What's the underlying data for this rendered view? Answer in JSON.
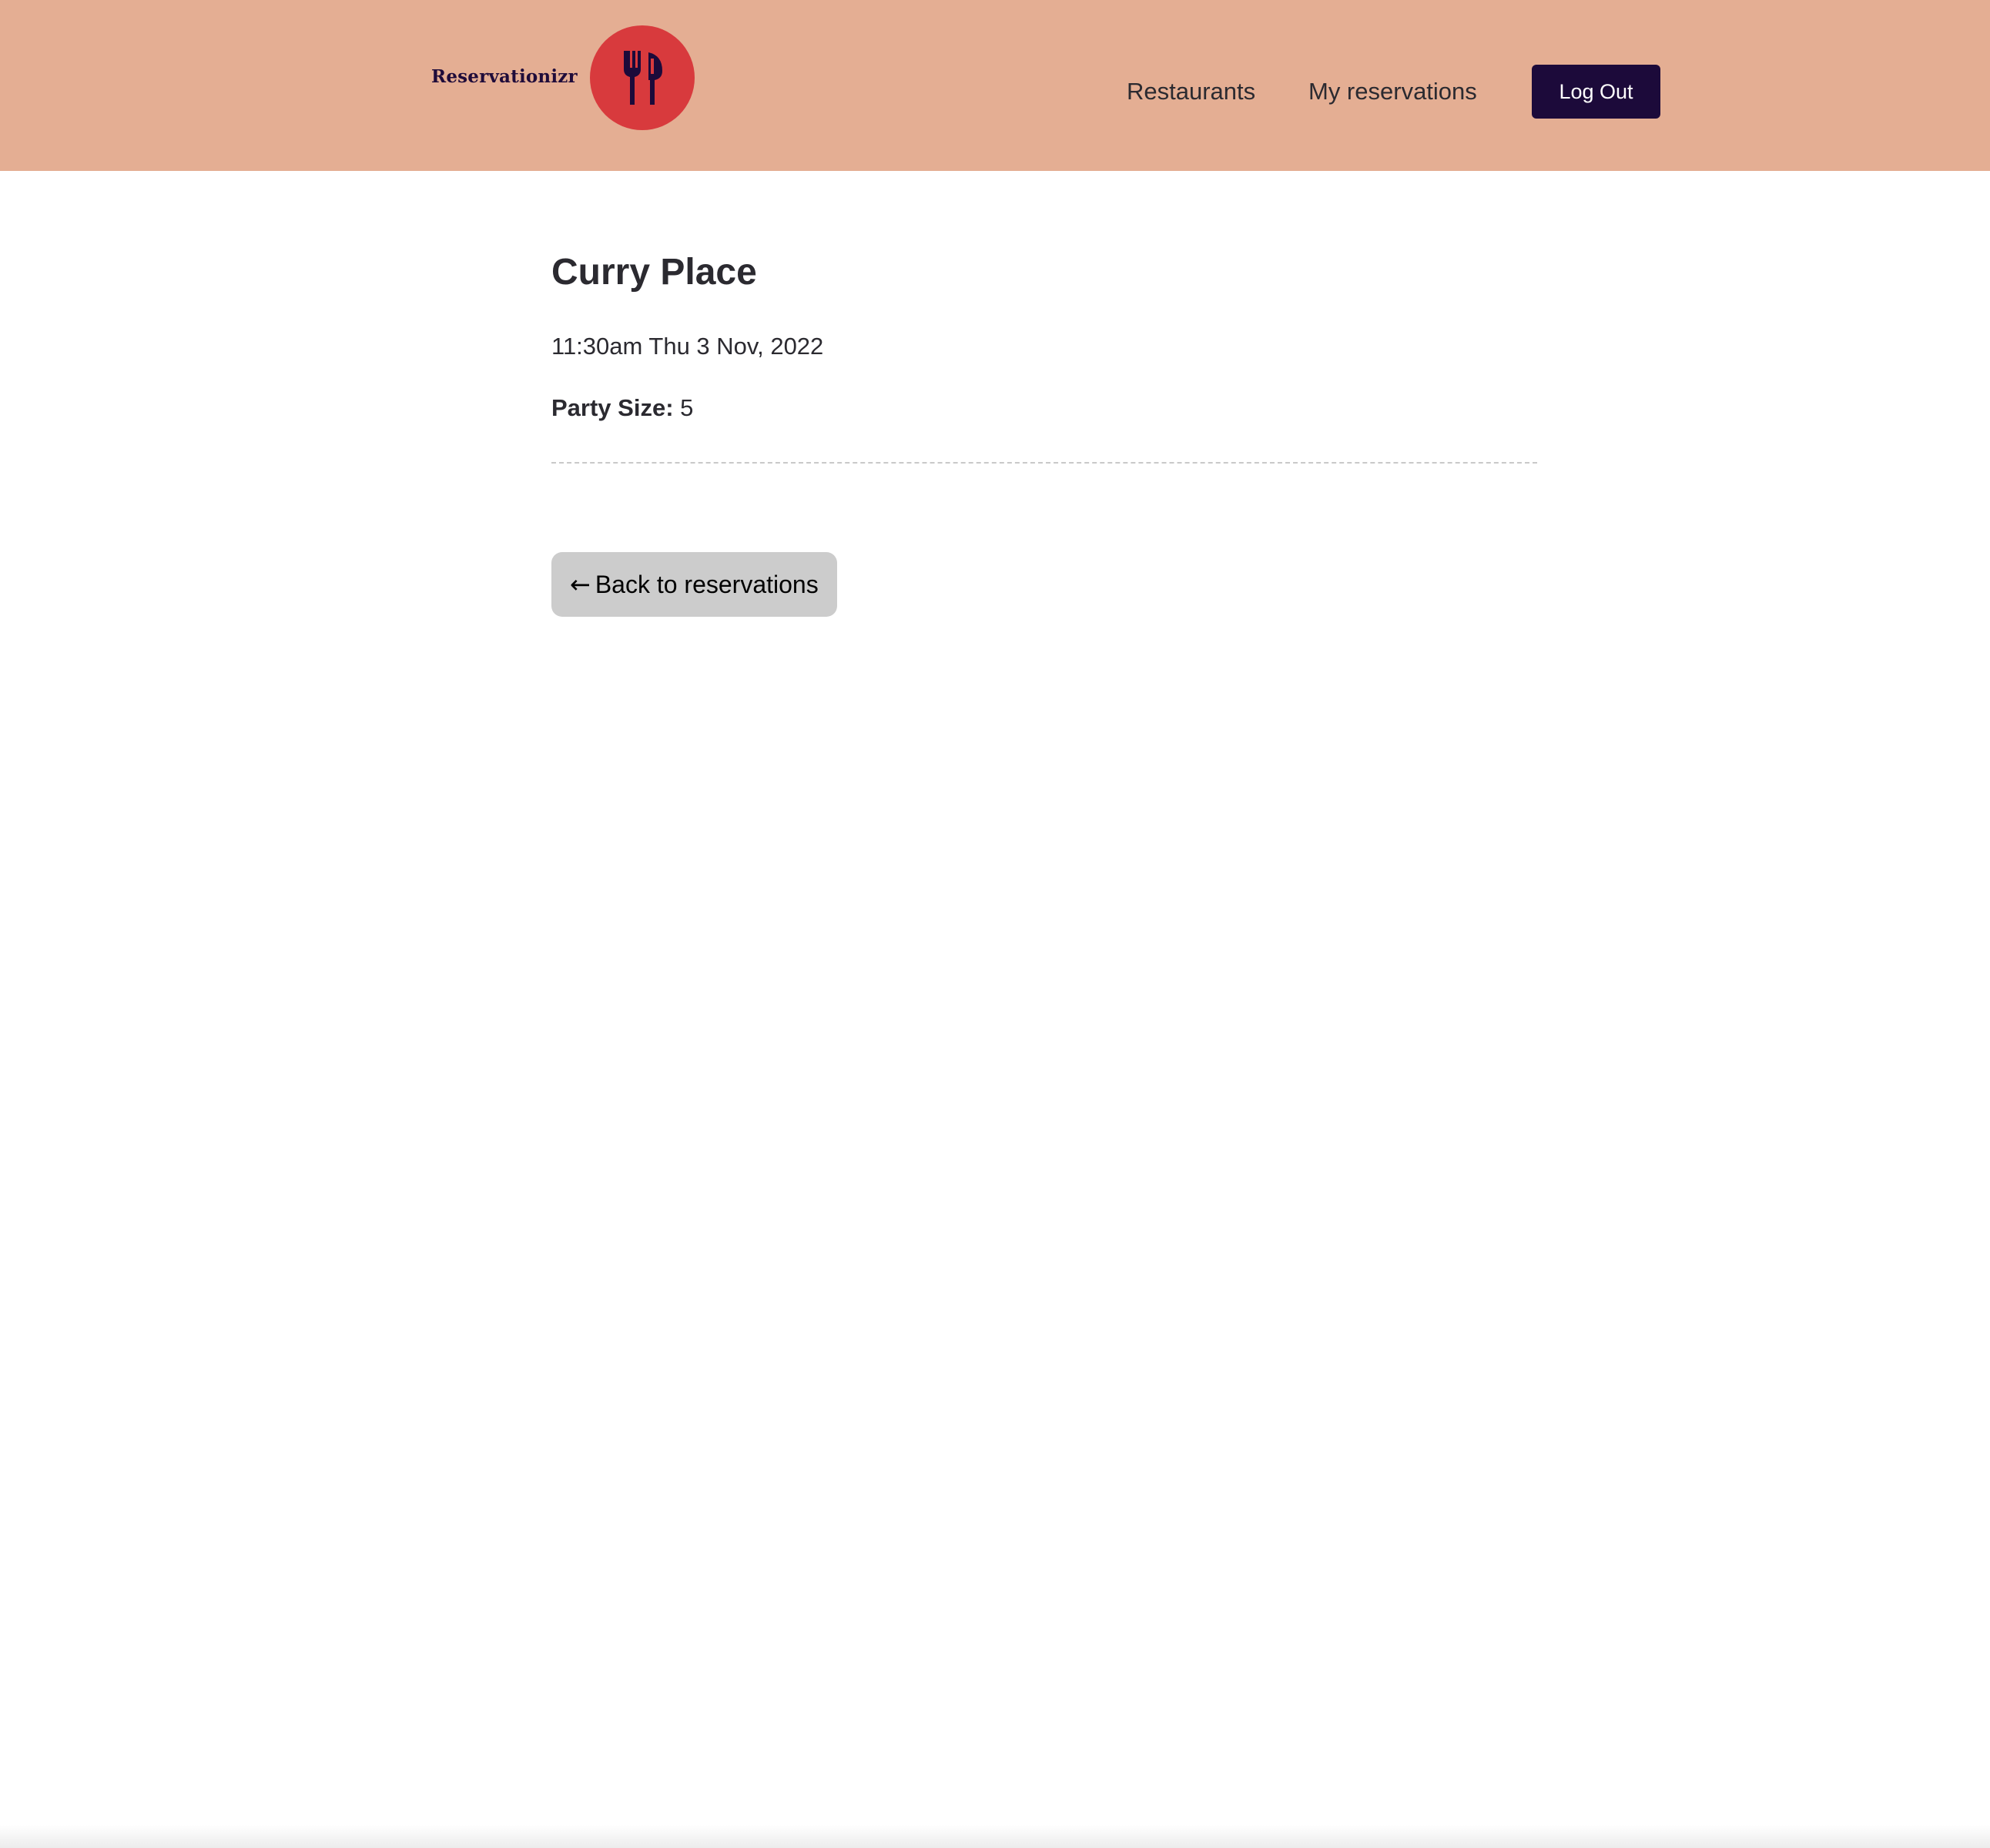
{
  "header": {
    "brand_name": "Reservationizr",
    "logo_icon": "fork-and-knife-icon",
    "background_color": "#e4ae93",
    "logo_color": "#d83a3d",
    "nav": {
      "restaurants_label": "Restaurants",
      "my_reservations_label": "My reservations"
    },
    "logout_label": "Log Out",
    "logout_color": "#1c0a3a"
  },
  "reservation": {
    "restaurant_name": "Curry Place",
    "datetime": "11:30am Thu 3 Nov, 2022",
    "party_size_label": "Party Size:",
    "party_size_value": "5"
  },
  "back_button": {
    "arrow": "←",
    "label": "Back to reservations"
  }
}
